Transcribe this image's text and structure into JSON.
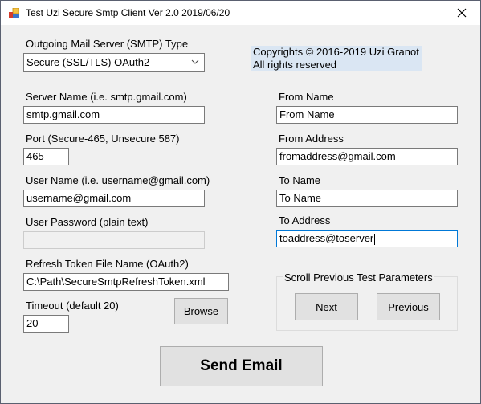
{
  "window": {
    "title": "Test Uzi Secure Smtp Client Ver 2.0 2019/06/20",
    "icon": "app-icon",
    "close_icon": "close-icon"
  },
  "smtp_type": {
    "label": "Outgoing Mail Server (SMTP) Type",
    "selected": "Secure (SSL/TLS) OAuth2"
  },
  "copyright": {
    "line1": "Copyrights © 2016-2019 Uzi Granot",
    "line2": "All rights reserved"
  },
  "left_fields": {
    "server_name": {
      "label": "Server Name (i.e. smtp.gmail.com)",
      "value": "smtp.gmail.com"
    },
    "port": {
      "label": "Port (Secure-465, Unsecure 587)",
      "value": "465"
    },
    "user_name": {
      "label": "User Name (i.e. username@gmail.com)",
      "value": "username@gmail.com"
    },
    "user_password": {
      "label": "User Password (plain text)",
      "value": ""
    },
    "refresh_token": {
      "label": "Refresh Token File Name (OAuth2)",
      "value": "C:\\Path\\SecureSmtpRefreshToken.xml"
    },
    "timeout": {
      "label": "Timeout (default 20)",
      "value": "20"
    }
  },
  "right_fields": {
    "from_name": {
      "label": "From Name",
      "value": "From Name"
    },
    "from_address": {
      "label": "From Address",
      "value": "fromaddress@gmail.com"
    },
    "to_name": {
      "label": "To Name",
      "value": "To Name"
    },
    "to_address": {
      "label": "To Address",
      "value": "toaddress@toserver"
    }
  },
  "buttons": {
    "browse": "Browse",
    "next": "Next",
    "previous": "Previous",
    "send": "Send Email"
  },
  "scroll_group": {
    "title": "Scroll Previous Test Parameters"
  }
}
